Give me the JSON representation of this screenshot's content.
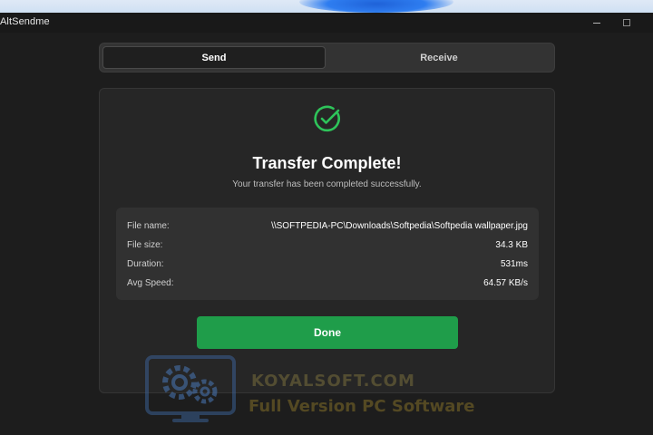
{
  "window": {
    "title": "AltSendme"
  },
  "tabs": [
    {
      "label": "Send",
      "active": true
    },
    {
      "label": "Receive",
      "active": false
    }
  ],
  "card": {
    "icon": "check-circle-icon",
    "title": "Transfer Complete!",
    "subtitle": "Your transfer has been completed successfully.",
    "details": [
      {
        "label": "File name:",
        "value": "\\\\SOFTPEDIA-PC\\Downloads\\Softpedia\\Softpedia wallpaper.jpg"
      },
      {
        "label": "File size:",
        "value": "34.3 KB"
      },
      {
        "label": "Duration:",
        "value": "531ms"
      },
      {
        "label": "Avg Speed:",
        "value": "64.57 KB/s"
      }
    ],
    "done_label": "Done"
  },
  "watermark": {
    "title": "KOYALSOFT.COM",
    "subtitle": "Full Version PC Software"
  },
  "colors": {
    "accent": "#1f9d4a",
    "check": "#2ec45a",
    "background": "#1d1d1d",
    "card": "#262626"
  }
}
